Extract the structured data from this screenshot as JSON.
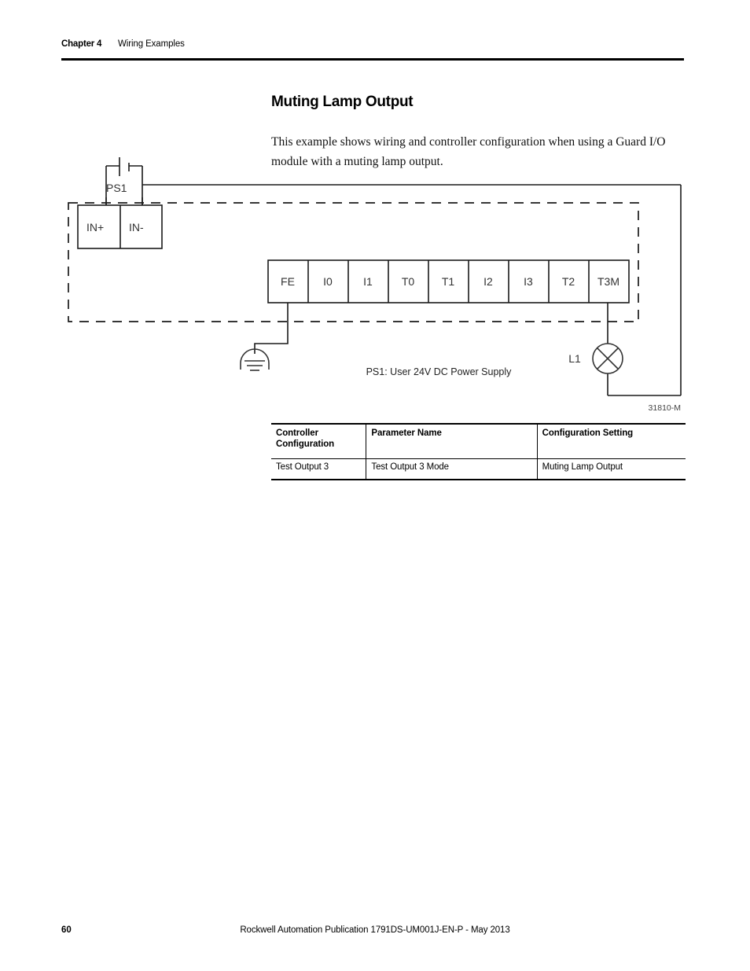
{
  "header": {
    "chapter": "Chapter 4",
    "section": "Wiring Examples"
  },
  "title": "Muting Lamp Output",
  "intro": "This example shows wiring and controller configuration when using a Guard I/O module with a muting lamp output.",
  "diagram": {
    "power_supply_label": "PS1",
    "input_terminals": [
      {
        "label": "IN+"
      },
      {
        "label": "IN-"
      }
    ],
    "module_terminals": [
      {
        "label": "FE"
      },
      {
        "label": "I0"
      },
      {
        "label": "I1"
      },
      {
        "label": "T0"
      },
      {
        "label": "T1"
      },
      {
        "label": "I2"
      },
      {
        "label": "I3"
      },
      {
        "label": "T2"
      },
      {
        "label": "T3M"
      }
    ],
    "lamp_label": "L1",
    "caption": "PS1: User 24V DC Power Supply",
    "figure_id": "31810-M",
    "icons": {
      "ground": "earth-ground-icon",
      "lamp": "lamp-icon",
      "battery": "battery-icon"
    }
  },
  "table": {
    "headers": [
      "Controller Configuration",
      "Parameter Name",
      "Configuration Setting"
    ],
    "rows": [
      {
        "controller_configuration": "Test Output 3",
        "parameter_name": "Test Output 3 Mode",
        "configuration_setting": "Muting Lamp Output"
      }
    ]
  },
  "footer": {
    "page_number": "60",
    "publication": "Rockwell Automation Publication 1791DS-UM001J-EN-P - May 2013"
  }
}
